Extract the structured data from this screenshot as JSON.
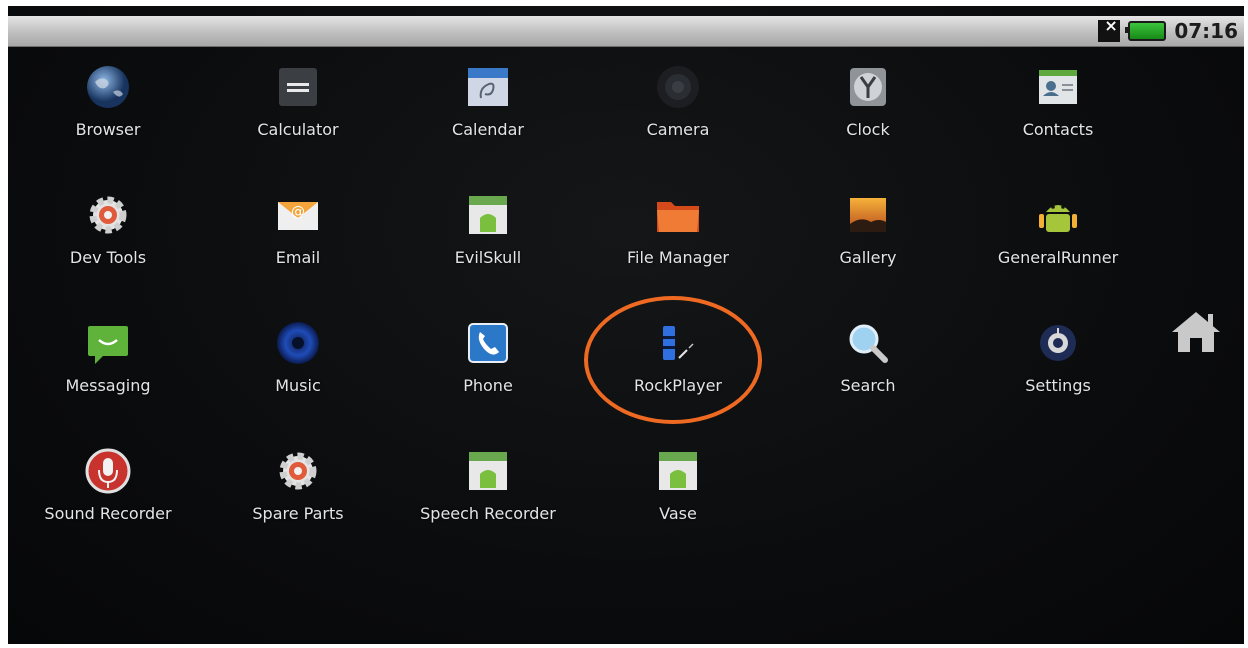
{
  "status_bar": {
    "signal_icon": "no-signal-icon",
    "battery_icon": "battery-icon",
    "time": "07:16"
  },
  "apps": [
    {
      "label": "Browser",
      "icon": "globe-icon"
    },
    {
      "label": "Calculator",
      "icon": "calculator-icon"
    },
    {
      "label": "Calendar",
      "icon": "calendar-icon"
    },
    {
      "label": "Camera",
      "icon": "camera-icon"
    },
    {
      "label": "Clock",
      "icon": "clock-icon"
    },
    {
      "label": "Contacts",
      "icon": "contacts-icon"
    },
    {
      "label": "Dev Tools",
      "icon": "gear-icon"
    },
    {
      "label": "Email",
      "icon": "envelope-icon"
    },
    {
      "label": "EvilSkull",
      "icon": "android-app-icon"
    },
    {
      "label": "File Manager",
      "icon": "folder-icon"
    },
    {
      "label": "Gallery",
      "icon": "picture-icon"
    },
    {
      "label": "GeneralRunner",
      "icon": "android-robot-icon"
    },
    {
      "label": "Messaging",
      "icon": "message-icon"
    },
    {
      "label": "Music",
      "icon": "speaker-icon"
    },
    {
      "label": "Phone",
      "icon": "phone-icon"
    },
    {
      "label": "RockPlayer",
      "icon": "rockplayer-icon"
    },
    {
      "label": "Search",
      "icon": "magnifier-icon"
    },
    {
      "label": "Settings",
      "icon": "settings-icon"
    },
    {
      "label": "Sound Recorder",
      "icon": "microphone-icon"
    },
    {
      "label": "Spare Parts",
      "icon": "gear-icon"
    },
    {
      "label": "Speech Recorder",
      "icon": "android-app-icon"
    },
    {
      "label": "Vase",
      "icon": "android-app-icon"
    }
  ],
  "home_button": {
    "icon": "home-icon"
  },
  "highlight": {
    "target": "RockPlayer",
    "color": "#ee6a22"
  }
}
